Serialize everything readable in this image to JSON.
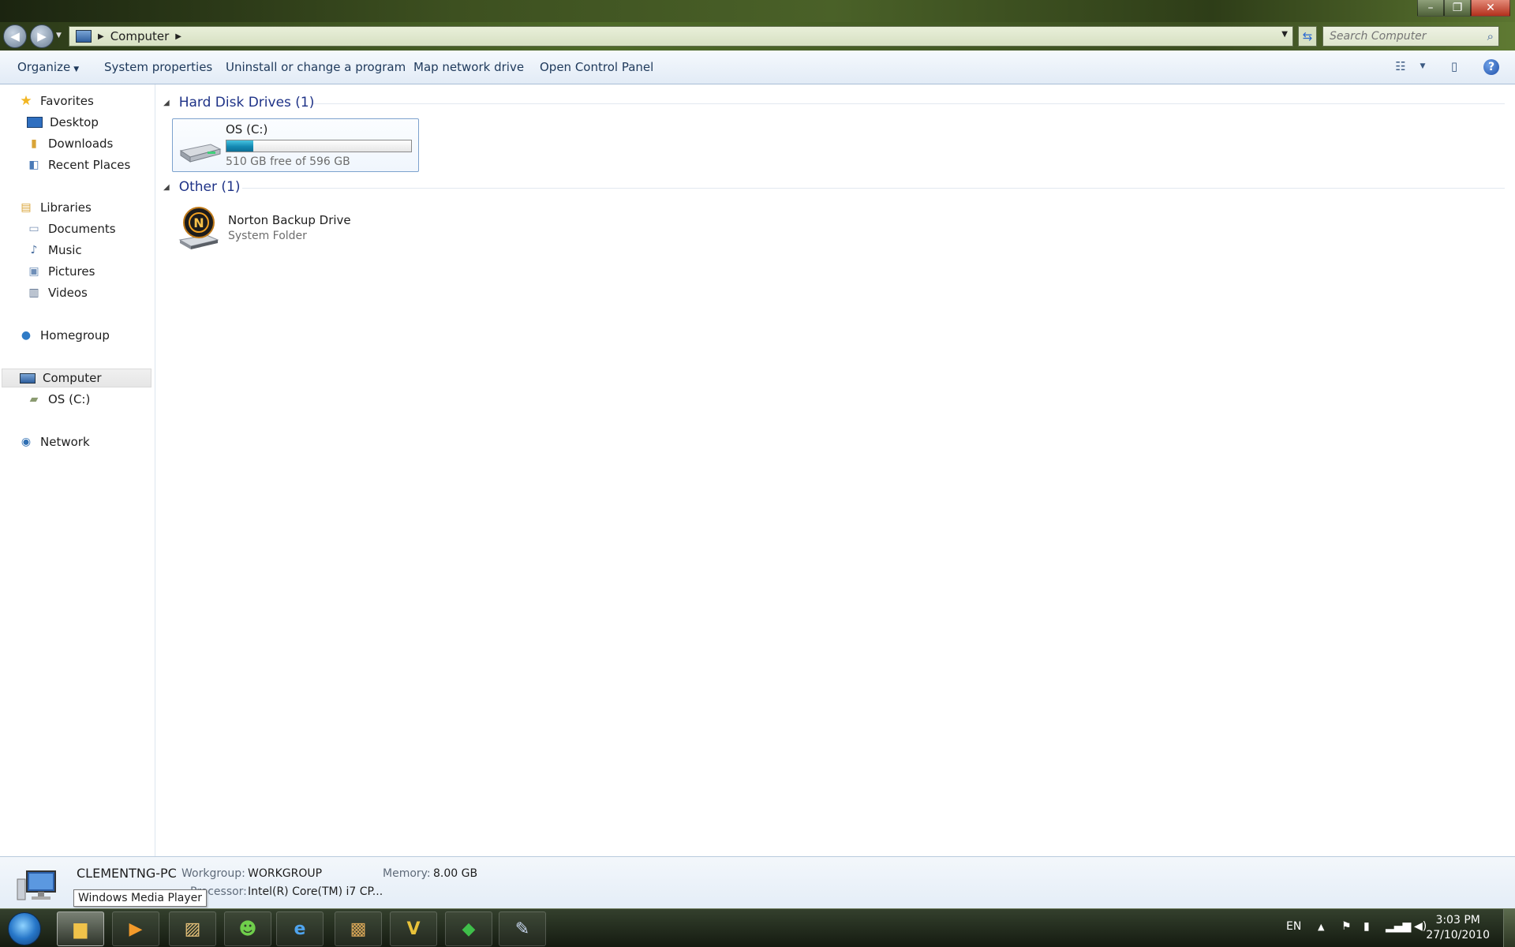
{
  "address": {
    "crumb": "Computer",
    "search_placeholder": "Search Computer"
  },
  "toolbar": {
    "organize": "Organize",
    "system_properties": "System properties",
    "uninstall": "Uninstall or change a program",
    "map_drive": "Map network drive",
    "control_panel": "Open Control Panel"
  },
  "sidebar": {
    "favorites": "Favorites",
    "desktop": "Desktop",
    "downloads": "Downloads",
    "recent_places": "Recent Places",
    "libraries": "Libraries",
    "documents": "Documents",
    "music": "Music",
    "pictures": "Pictures",
    "videos": "Videos",
    "homegroup": "Homegroup",
    "computer": "Computer",
    "os_c": "OS (C:)",
    "network": "Network"
  },
  "content": {
    "hdd_header": "Hard Disk Drives (1)",
    "drive_name": "OS (C:)",
    "drive_free": "510 GB free of 596 GB",
    "drive_used_fraction": 0.144,
    "other_header": "Other (1)",
    "norton_name": "Norton Backup Drive",
    "norton_sub": "System Folder"
  },
  "details": {
    "pc_name": "CLEMENTNG-PC",
    "workgroup_label": "Workgroup:",
    "workgroup_value": "WORKGROUP",
    "memory_label": "Memory:",
    "memory_value": "8.00 GB",
    "processor_label": "Processor:",
    "processor_value": "Intel(R) Core(TM) i7 CP..."
  },
  "tooltip": "Windows Media Player",
  "taskbar": {
    "lang": "EN",
    "time": "3:03 PM",
    "date": "27/10/2010"
  },
  "colors": {
    "accent": "#1e3287",
    "bar_fill": "#1489b3",
    "selection": "#7da2ce"
  }
}
